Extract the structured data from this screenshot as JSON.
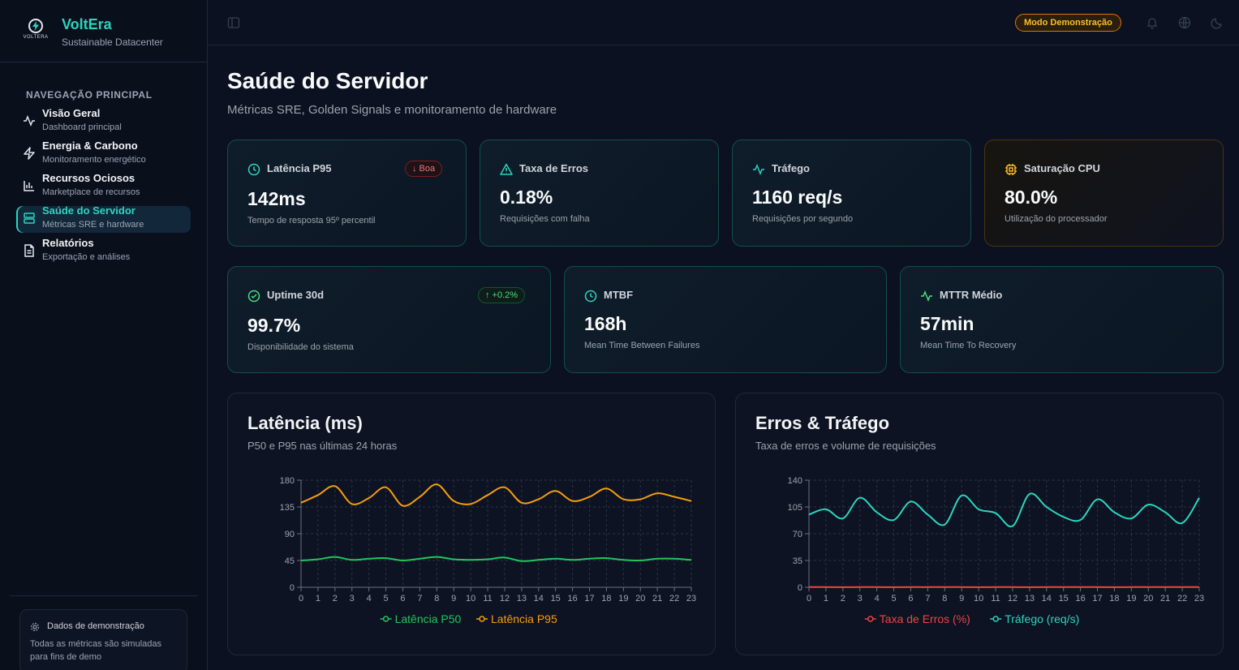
{
  "brand": {
    "name": "VoltEra",
    "subtitle": "Sustainable Datacenter",
    "logo_text": "VOLTERA"
  },
  "sidebar": {
    "heading": "NAVEGAÇÃO PRINCIPAL",
    "items": [
      {
        "label": "Visão Geral",
        "desc": "Dashboard principal",
        "icon": "activity-icon",
        "active": false
      },
      {
        "label": "Energia & Carbono",
        "desc": "Monitoramento energético",
        "icon": "zap-icon",
        "active": false
      },
      {
        "label": "Recursos Ociosos",
        "desc": "Marketplace de recursos",
        "icon": "bar-chart-icon",
        "active": false
      },
      {
        "label": "Saúde do Servidor",
        "desc": "Métricas SRE e hardware",
        "icon": "server-icon",
        "active": true
      },
      {
        "label": "Relatórios",
        "desc": "Exportação e análises",
        "icon": "file-text-icon",
        "active": false
      }
    ],
    "demo": {
      "title": "Dados de demonstração",
      "text": "Todas as métricas são simuladas para fins de demo"
    }
  },
  "topbar": {
    "demo_badge": "Modo Demonstração"
  },
  "page": {
    "title": "Saúde do Servidor",
    "subtitle": "Métricas SRE, Golden Signals e monitoramento de hardware"
  },
  "cards": {
    "latency": {
      "title": "Latência P95",
      "value": "142ms",
      "desc": "Tempo de resposta 95º percentil",
      "badge": "↓ Boa"
    },
    "errors": {
      "title": "Taxa de Erros",
      "value": "0.18%",
      "desc": "Requisições com falha"
    },
    "traffic": {
      "title": "Tráfego",
      "value": "1160 req/s",
      "desc": "Requisições por segundo"
    },
    "cpu": {
      "title": "Saturação CPU",
      "value": "80.0%",
      "desc": "Utilização do processador"
    },
    "uptime": {
      "title": "Uptime 30d",
      "value": "99.7%",
      "desc": "Disponibilidade do sistema",
      "badge": "↑ +0.2%"
    },
    "mtbf": {
      "title": "MTBF",
      "value": "168h",
      "desc": "Mean Time Between Failures"
    },
    "mttr": {
      "title": "MTTR Médio",
      "value": "57min",
      "desc": "Mean Time To Recovery"
    }
  },
  "colors": {
    "accent": "#2dd4bf",
    "p50": "#22c55e",
    "p95": "#f59e0b",
    "errors": "#ef4444",
    "traffic": "#2dd4bf",
    "warn": "#fbbf24"
  },
  "chart_data": [
    {
      "type": "line",
      "title": "Latência (ms)",
      "subtitle": "P50 e P95 nas últimas 24 horas",
      "x": [
        0,
        1,
        2,
        3,
        4,
        5,
        6,
        7,
        8,
        9,
        10,
        11,
        12,
        13,
        14,
        15,
        16,
        17,
        18,
        19,
        20,
        21,
        22,
        23
      ],
      "ylim": [
        0,
        180
      ],
      "yticks": [
        0,
        45,
        90,
        135,
        180
      ],
      "grid": true,
      "legend_position": "bottom",
      "series": [
        {
          "name": "Latência P50",
          "color": "#22c55e",
          "values": [
            45,
            47,
            51,
            46,
            48,
            49,
            45,
            48,
            51,
            47,
            46,
            47,
            50,
            44,
            46,
            48,
            46,
            48,
            49,
            46,
            45,
            48,
            48,
            46
          ]
        },
        {
          "name": "Latência P95",
          "color": "#f59e0b",
          "values": [
            142,
            155,
            170,
            140,
            150,
            168,
            137,
            152,
            173,
            145,
            140,
            155,
            168,
            142,
            148,
            162,
            145,
            152,
            166,
            148,
            148,
            158,
            152,
            145
          ]
        }
      ]
    },
    {
      "type": "line",
      "title": "Erros & Tráfego",
      "subtitle": "Taxa de erros e volume de requisições",
      "x": [
        0,
        1,
        2,
        3,
        4,
        5,
        6,
        7,
        8,
        9,
        10,
        11,
        12,
        13,
        14,
        15,
        16,
        17,
        18,
        19,
        20,
        21,
        22,
        23
      ],
      "ylim": [
        0,
        140
      ],
      "yticks": [
        0,
        35,
        70,
        105,
        140
      ],
      "grid": true,
      "legend_position": "bottom",
      "series": [
        {
          "name": "Taxa de Erros (%)",
          "color": "#ef4444",
          "values": [
            0.2,
            0.2,
            0.1,
            0.2,
            0.2,
            0.1,
            0.2,
            0.2,
            0.3,
            0.2,
            0.1,
            0.2,
            0.2,
            0.1,
            0.2,
            0.2,
            0.2,
            0.2,
            0.1,
            0.2,
            0.2,
            0.2,
            0.2,
            0.2
          ]
        },
        {
          "name": "Tráfego (req/s)",
          "color": "#2dd4bf",
          "values": [
            95,
            102,
            90,
            117,
            98,
            88,
            112,
            95,
            82,
            120,
            102,
            97,
            80,
            122,
            105,
            92,
            88,
            115,
            98,
            90,
            108,
            98,
            84,
            117
          ]
        }
      ]
    }
  ]
}
